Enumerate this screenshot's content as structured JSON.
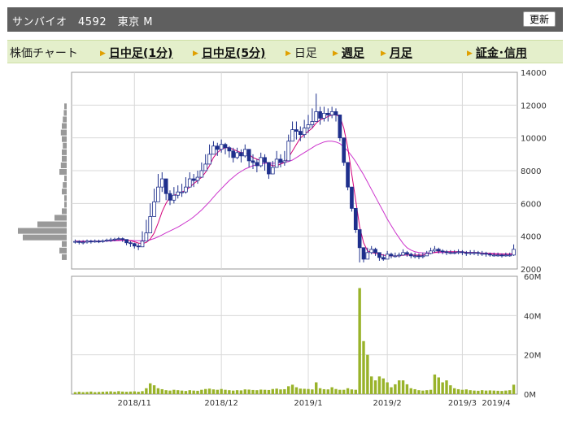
{
  "header": {
    "title": "サンバイオ　4592　東京 M",
    "refresh_label": "更新"
  },
  "nav": {
    "chart_label": "株価チャート",
    "items": [
      {
        "label": "日中足(1分)",
        "link": true
      },
      {
        "label": "日中足(5分)",
        "link": true
      },
      {
        "label": "日足",
        "link": false
      },
      {
        "label": "週足",
        "link": true
      },
      {
        "label": "月足",
        "link": true
      }
    ],
    "margin_label": "証金･信用"
  },
  "colors": {
    "up_candle": "#ffffff",
    "down_candle": "#1e2f8c",
    "short_ma": "#d4007a",
    "long_ma": "#cc33cc",
    "volume": "#99b32a"
  },
  "chart_data": [
    {
      "type": "candlestick",
      "ylim": [
        2000,
        14000
      ],
      "yticks": [
        "14000",
        "12000",
        "10000",
        "8000",
        "6000",
        "4000",
        "2000"
      ],
      "xtick_labels": [
        "2018/11",
        "2018/12",
        "2019/1",
        "2019/2",
        "2019/3",
        "2019/4"
      ],
      "close": [
        3680,
        3620,
        3640,
        3700,
        3650,
        3700,
        3680,
        3720,
        3760,
        3780,
        3820,
        3850,
        3800,
        3600,
        3550,
        3400,
        3350,
        3700,
        4200,
        5200,
        6100,
        7000,
        7500,
        6600,
        6200,
        6500,
        6700,
        6700,
        7000,
        7500,
        7400,
        7600,
        8000,
        8400,
        9000,
        9500,
        9300,
        9600,
        9400,
        9200,
        8800,
        9100,
        8900,
        9300,
        8600,
        8500,
        8300,
        8800,
        8500,
        7800,
        8200,
        8700,
        8500,
        8600,
        9800,
        10500,
        10400,
        10200,
        10600,
        10800,
        11000,
        11600,
        11200,
        11500,
        11400,
        11600,
        11400,
        10000,
        8500,
        7000,
        5700,
        4400,
        3300,
        2600,
        3000,
        3200,
        3000,
        2700,
        2600,
        2900,
        2800,
        2800,
        2850,
        3000,
        2900,
        2800,
        2800,
        2750,
        2800,
        2950,
        3100,
        3200,
        3100,
        3050,
        3000,
        3000,
        3000,
        3050,
        3000,
        2950,
        3000,
        3000,
        2950,
        2950,
        2900,
        2850,
        2850,
        2850,
        2800,
        2850,
        2850,
        3200
      ],
      "high": [
        3800,
        3750,
        3760,
        3800,
        3780,
        3800,
        3790,
        3800,
        3850,
        3900,
        3900,
        3950,
        3920,
        3800,
        3700,
        3600,
        3550,
        4300,
        5000,
        6000,
        6900,
        7800,
        7900,
        7300,
        6800,
        7000,
        7100,
        7200,
        7600,
        7900,
        7800,
        8000,
        8500,
        9000,
        9600,
        9800,
        9700,
        9900,
        9700,
        9500,
        9400,
        9400,
        9300,
        9600,
        9100,
        9000,
        8700,
        9100,
        9000,
        8400,
        8600,
        9200,
        9000,
        9200,
        10200,
        11000,
        11000,
        10700,
        11100,
        11400,
        11800,
        12700,
        11900,
        11900,
        11800,
        11900,
        11800,
        11000,
        9000,
        7500,
        6000,
        4800,
        3700,
        3100,
        3300,
        3400,
        3300,
        3000,
        2900,
        3100,
        3000,
        3000,
        3000,
        3200,
        3100,
        3000,
        3000,
        2950,
        3000,
        3100,
        3300,
        3400,
        3300,
        3200,
        3150,
        3150,
        3150,
        3200,
        3150,
        3100,
        3150,
        3150,
        3100,
        3100,
        3050,
        3000,
        3000,
        3000,
        2950,
        3000,
        3000,
        3500
      ],
      "low": [
        3550,
        3500,
        3500,
        3550,
        3550,
        3600,
        3580,
        3600,
        3650,
        3650,
        3700,
        3750,
        3650,
        3450,
        3350,
        3250,
        3150,
        3400,
        3800,
        4500,
        5500,
        6500,
        6700,
        6200,
        5900,
        6000,
        6300,
        6400,
        6600,
        7000,
        7000,
        7200,
        7600,
        8000,
        8500,
        9000,
        8900,
        9100,
        9000,
        8800,
        8500,
        8700,
        8500,
        8800,
        8200,
        8100,
        7900,
        8200,
        8000,
        7500,
        7900,
        8300,
        8200,
        8300,
        9000,
        9900,
        9900,
        9800,
        10000,
        10300,
        10600,
        11000,
        10800,
        11000,
        11000,
        11200,
        11000,
        9800,
        8300,
        6800,
        5500,
        4200,
        2400,
        2400,
        2700,
        2900,
        2800,
        2500,
        2500,
        2600,
        2650,
        2700,
        2700,
        2800,
        2750,
        2650,
        2650,
        2600,
        2650,
        2800,
        2900,
        3000,
        2950,
        2900,
        2850,
        2900,
        2900,
        2900,
        2850,
        2800,
        2850,
        2850,
        2800,
        2800,
        2750,
        2750,
        2750,
        2750,
        2700,
        2750,
        2750,
        2800
      ],
      "ma_short": [
        3700,
        3680,
        3670,
        3670,
        3670,
        3690,
        3690,
        3700,
        3720,
        3740,
        3760,
        3780,
        3790,
        3760,
        3730,
        3660,
        3580,
        3550,
        3620,
        3820,
        4200,
        4800,
        5500,
        6000,
        6400,
        6500,
        6600,
        6700,
        6800,
        7000,
        7200,
        7400,
        7600,
        7900,
        8300,
        8800,
        9100,
        9300,
        9400,
        9400,
        9300,
        9200,
        9100,
        9100,
        9000,
        8800,
        8700,
        8600,
        8600,
        8400,
        8300,
        8300,
        8400,
        8500,
        8800,
        9200,
        9600,
        10000,
        10200,
        10400,
        10600,
        10900,
        11100,
        11200,
        11300,
        11400,
        11400,
        11300,
        10600,
        9400,
        7800,
        6200,
        4600,
        3600,
        3100,
        3000,
        2950,
        2900,
        2850,
        2800,
        2800,
        2800,
        2800,
        2850,
        2850,
        2850,
        2850,
        2850,
        2850,
        2900,
        2950,
        3000,
        3050,
        3050,
        3050,
        3050,
        3050,
        3050,
        3050,
        3000,
        3000,
        3000,
        3000,
        2950,
        2950,
        2950,
        2900,
        2900,
        2900,
        2900,
        2900,
        2950
      ],
      "ma_long": [
        3700,
        3700,
        3700,
        3700,
        3700,
        3700,
        3700,
        3700,
        3700,
        3710,
        3720,
        3730,
        3740,
        3740,
        3740,
        3730,
        3720,
        3720,
        3730,
        3780,
        3860,
        3960,
        4080,
        4200,
        4320,
        4440,
        4560,
        4700,
        4850,
        5000,
        5180,
        5380,
        5600,
        5850,
        6100,
        6380,
        6650,
        6900,
        7150,
        7400,
        7600,
        7800,
        7950,
        8100,
        8200,
        8300,
        8350,
        8400,
        8450,
        8450,
        8450,
        8450,
        8500,
        8500,
        8550,
        8650,
        8800,
        8950,
        9100,
        9250,
        9400,
        9550,
        9650,
        9750,
        9800,
        9800,
        9750,
        9650,
        9450,
        9200,
        8900,
        8550,
        8150,
        7750,
        7300,
        6850,
        6400,
        5950,
        5500,
        5050,
        4650,
        4250,
        3900,
        3550,
        3300,
        3150,
        3050,
        3000,
        2980,
        2980,
        2990,
        3000,
        3000,
        3000,
        3000,
        3000,
        3000,
        3000,
        3000,
        3000,
        3000,
        3000,
        2980,
        2970,
        2960,
        2950,
        2940,
        2930,
        2920,
        2910,
        2900,
        2900
      ],
      "ma_short_label": "",
      "ma_long_label": ""
    },
    {
      "type": "bar",
      "ylim": [
        0,
        60000000
      ],
      "yticks": [
        "60M",
        "40M",
        "20M",
        "0M"
      ],
      "unit": "shares",
      "values": [
        1000000,
        1200000,
        1000000,
        1100000,
        1300000,
        1000000,
        1100000,
        1200000,
        1300000,
        1400000,
        1200000,
        1500000,
        1300000,
        1200000,
        1300000,
        1400000,
        1200000,
        1500000,
        3000000,
        5500000,
        4500000,
        3000000,
        2500000,
        2000000,
        1800000,
        2200000,
        2000000,
        1800000,
        1600000,
        2000000,
        1800000,
        1700000,
        2200000,
        2600000,
        2800000,
        2400000,
        2200000,
        2600000,
        2200000,
        2000000,
        1800000,
        2000000,
        1900000,
        2400000,
        2300000,
        2100000,
        2000000,
        2300000,
        2200000,
        2100000,
        2600000,
        2800000,
        2400000,
        2500000,
        4000000,
        4800000,
        3500000,
        2800000,
        2700000,
        2600000,
        2400000,
        6000000,
        3000000,
        2500000,
        2400000,
        3500000,
        2600000,
        2200000,
        2200000,
        3000000,
        2400000,
        2200000,
        54000000,
        27000000,
        20000000,
        9000000,
        7000000,
        9000000,
        8000000,
        6000000,
        3500000,
        5000000,
        7000000,
        7000000,
        5000000,
        3000000,
        2500000,
        2000000,
        1800000,
        2000000,
        2200000,
        10000000,
        8500000,
        6000000,
        7000000,
        4500000,
        3000000,
        2500000,
        2200000,
        2400000,
        2000000,
        1800000,
        1700000,
        2000000,
        1800000,
        1900000,
        1800000,
        1700000,
        1600000,
        1800000,
        2000000,
        4800000
      ],
      "color": "#99b32a"
    }
  ]
}
